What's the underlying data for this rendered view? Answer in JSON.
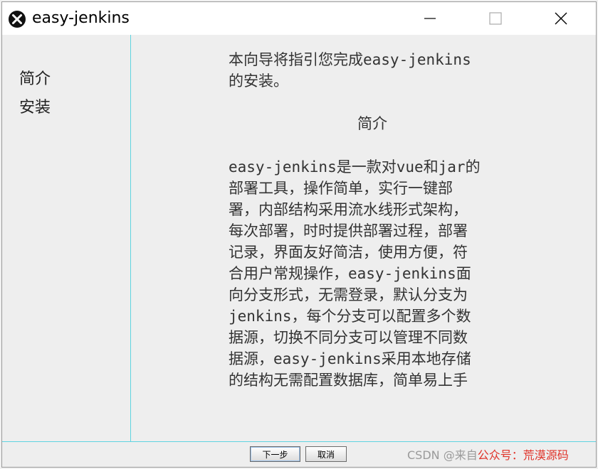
{
  "window": {
    "title": "easy-jenkins"
  },
  "sidebar": {
    "items": [
      {
        "label": "简介"
      },
      {
        "label": "安装"
      }
    ]
  },
  "content": {
    "intro_lines": [
      "本向导将指引您完成easy-jenkins",
      "的安装。"
    ],
    "heading": "简介",
    "body_lines": [
      "easy-jenkins是一款对vue和jar的",
      "部署工具，操作简单，实行一键部",
      "署，内部结构采用流水线形式架构，",
      "每次部署，时时提供部署过程，部署",
      "记录，界面友好简洁，使用方便，符",
      "合用户常规操作，easy-jenkins面",
      "向分支形式，无需登录，默认分支为",
      "jenkins，每个分支可以配置多个数",
      "据源，切换不同分支可以管理不同数",
      "据源，easy-jenkins采用本地存储",
      "的结构无需配置数据库，简单易上手"
    ]
  },
  "footer": {
    "next_label": "下一步",
    "cancel_label": "取消"
  },
  "watermark": {
    "prefix": "CSDN @来自",
    "highlight": "公众号：荒漠源码"
  },
  "colors": {
    "divider": "#5fd3e0",
    "watermark_red": "#e0342a"
  },
  "icons": {
    "app": "circle-x-icon",
    "minimize": "minimize-icon",
    "maximize": "maximize-icon",
    "close": "close-icon"
  }
}
